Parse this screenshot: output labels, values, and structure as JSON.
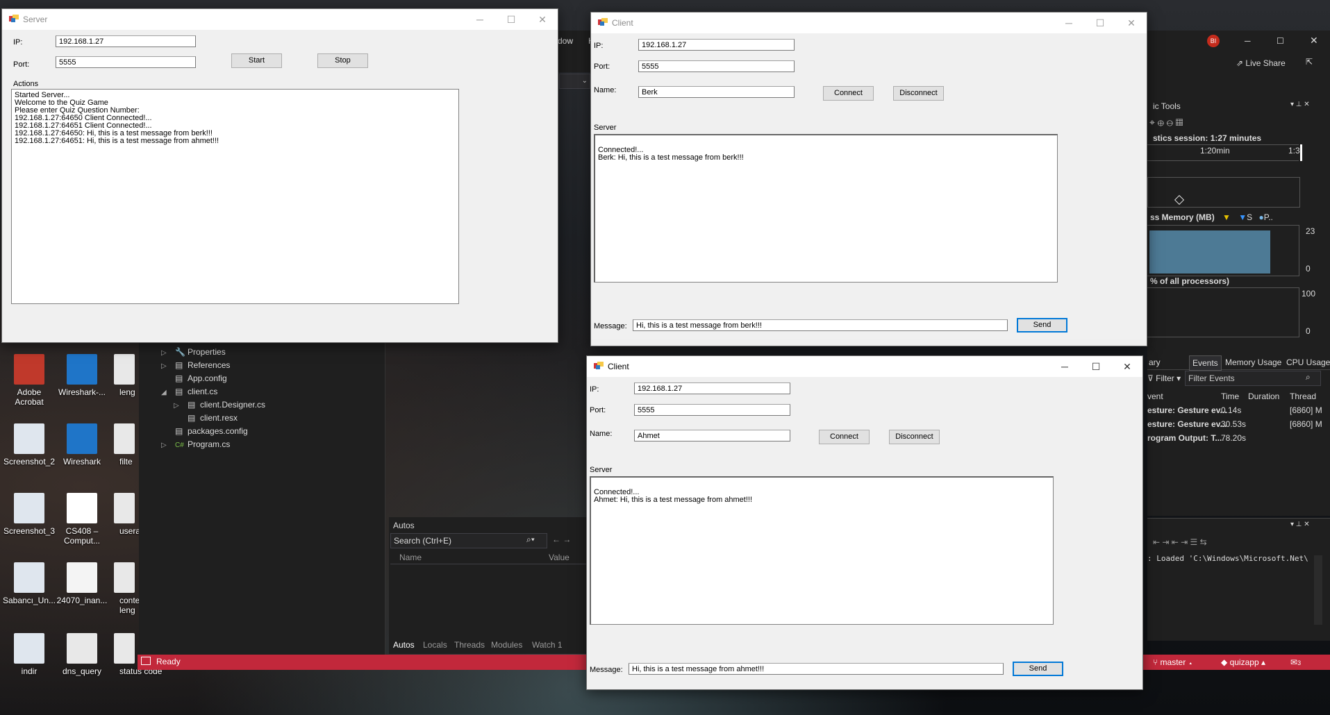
{
  "desktop": {
    "icons": [
      {
        "label": "Adobe\nAcrobat",
        "icon": "acrobat-icon"
      },
      {
        "label": "Wireshark-...",
        "icon": "wireshark-icon"
      },
      {
        "label": "leng",
        "icon": "file-icon"
      },
      {
        "label": "Screenshot_2",
        "icon": "image-icon"
      },
      {
        "label": "Wireshark",
        "icon": "wireshark-icon"
      },
      {
        "label": "filte",
        "icon": "file-icon"
      },
      {
        "label": "Screenshot_3",
        "icon": "image-icon"
      },
      {
        "label": "CS408 –\nComput...",
        "icon": "pdf-icon"
      },
      {
        "label": "userag",
        "icon": "file-icon"
      },
      {
        "label": "Sabancı_Un...",
        "icon": "image-icon"
      },
      {
        "label": "24070_inan...",
        "icon": "binary-file-icon"
      },
      {
        "label": "conte\nleng",
        "icon": "file-icon"
      },
      {
        "label": "indir",
        "icon": "image-icon"
      },
      {
        "label": "dns_query",
        "icon": "file-icon"
      },
      {
        "label": "status code",
        "icon": "file-icon"
      }
    ]
  },
  "ide": {
    "menu_partial": "dow",
    "menu_partial2": "H",
    "account_badge": "BI",
    "live_share": "Live Share",
    "solution_tree": [
      {
        "label": "Properties",
        "icon": "wrench-icon"
      },
      {
        "label": "References",
        "icon": "references-icon"
      },
      {
        "label": "App.config",
        "icon": "config-icon"
      },
      {
        "label": "client.cs",
        "icon": "form-icon"
      },
      {
        "label": "client.Designer.cs",
        "icon": "file-icon"
      },
      {
        "label": "client.resx",
        "icon": "file-icon"
      },
      {
        "label": "packages.config",
        "icon": "config-icon"
      },
      {
        "label": "Program.cs",
        "icon": "csharp-icon"
      }
    ],
    "autos": {
      "title": "Autos",
      "search_placeholder": "Search (Ctrl+E)",
      "col_name": "Name",
      "col_value": "Value",
      "tabs": [
        "Autos",
        "Locals",
        "Threads",
        "Modules",
        "Watch 1"
      ]
    },
    "diag": {
      "title": "ic Tools",
      "session": "stics session: 1:27 minutes",
      "tick1": "1:20min",
      "tick2": "1:3",
      "memory_label": "ss Memory (MB)",
      "legend_s": "S",
      "legend_p": "P..",
      "mem_max": "23",
      "mem_min": "0",
      "cpu_label": "% of all processors)",
      "cpu_max": "100",
      "cpu_min": "0",
      "tabs": [
        "ary",
        "Events",
        "Memory Usage",
        "CPU Usage"
      ],
      "filter": "Filter",
      "filter_events": "Filter Events",
      "cols": [
        "vent",
        "Time",
        "Duration",
        "Thread"
      ],
      "rows": [
        {
          "event": "esture: Gesture ev...",
          "time": "0.14s",
          "duration": "",
          "thread": "[6860] M"
        },
        {
          "event": "esture: Gesture ev...",
          "time": "30.53s",
          "duration": "",
          "thread": "[6860] M"
        },
        {
          "event": "rogram Output: T...",
          "time": "78.20s",
          "duration": "",
          "thread": ""
        }
      ]
    },
    "output_line": ": Loaded 'C:\\Windows\\Microsoft.Net\\",
    "status": {
      "ready": "Ready",
      "branch": "master",
      "repo": "quizapp",
      "notif": "3"
    }
  },
  "server": {
    "title": "Server",
    "ip_label": "IP:",
    "ip_value": "192.168.1.27",
    "port_label": "Port:",
    "port_value": "5555",
    "start": "Start",
    "stop": "Stop",
    "actions_label": "Actions",
    "log": [
      "Started Server...",
      "Welcome to the Quiz Game",
      "Please enter Quiz Question Number:",
      "192.168.1.27:64650  Client Connected!...",
      "192.168.1.27:64651  Client Connected!...",
      "192.168.1.27:64650: Hi, this is a test message from berk!!!",
      "192.168.1.27:64651: Hi, this is a test message from ahmet!!!"
    ]
  },
  "client1": {
    "title": "Client",
    "ip_label": "IP:",
    "ip_value": "192.168.1.27",
    "port_label": "Port:",
    "port_value": "5555",
    "name_label": "Name:",
    "name_value": "Berk",
    "connect": "Connect",
    "disconnect": "Disconnect",
    "server_label": "Server",
    "log": [
      "Connected!...",
      "Berk: Hi, this is a test message from berk!!!"
    ],
    "message_label": "Message:",
    "message_value": "Hi, this is a test message from berk!!!",
    "send": "Send"
  },
  "client2": {
    "title": "Client",
    "ip_label": "IP:",
    "ip_value": "192.168.1.27",
    "port_label": "Port:",
    "port_value": "5555",
    "name_label": "Name:",
    "name_value": "Ahmet",
    "connect": "Connect",
    "disconnect": "Disconnect",
    "server_label": "Server",
    "log": [
      "Connected!...",
      "Ahmet: Hi, this is a test message from ahmet!!!"
    ],
    "message_label": "Message:",
    "message_value": "Hi, this is a test message from ahmet!!!",
    "send": "Send"
  },
  "window_buttons": {
    "minimize": "─",
    "maximize": "☐",
    "close": "✕"
  }
}
